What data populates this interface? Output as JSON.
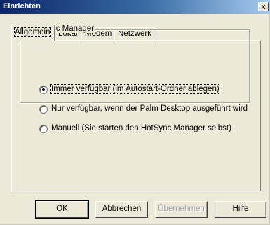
{
  "window": {
    "title": "Einrichten",
    "close_glyph": "x"
  },
  "tabs": [
    {
      "label": "Allgemein",
      "active": true
    },
    {
      "label": "Lokal",
      "active": false
    },
    {
      "label": "Modem",
      "active": false
    },
    {
      "label": "Netzwerk",
      "active": false
    }
  ],
  "group": {
    "title": "HotSync Manager",
    "options": [
      {
        "label": "Immer verfügbar (im Autostart-Ordner ablegen)",
        "checked": true
      },
      {
        "label": "Nur verfügbar, wenn der Palm Desktop ausgeführt wird",
        "checked": false
      },
      {
        "label": "Manuell (Sie starten den HotSync Manager selbst)",
        "checked": false
      }
    ]
  },
  "buttons": {
    "ok": "OK",
    "cancel": "Abbrechen",
    "apply": "Übernehmen",
    "help": "Hilfe"
  },
  "colors": {
    "title_gradient_start": "#0a246a",
    "title_gradient_end": "#a6caf0",
    "dialog_face": "#ece9d8"
  }
}
